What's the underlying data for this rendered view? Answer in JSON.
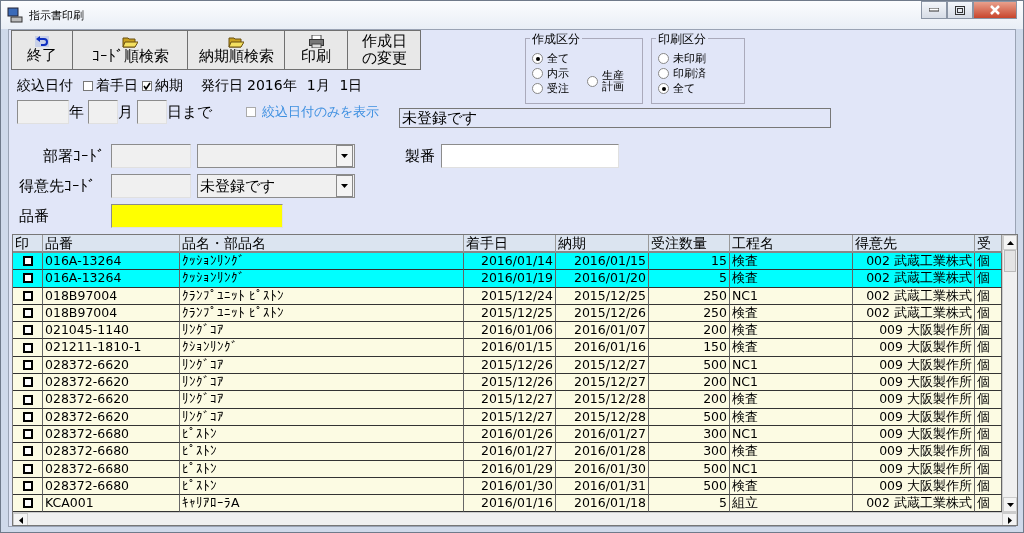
{
  "window": {
    "title": "指示書印刷"
  },
  "toolbar": [
    {
      "kind": "undo",
      "label": "終了"
    },
    {
      "kind": "folder",
      "label": "ｺｰﾄﾞ順検索"
    },
    {
      "kind": "folder",
      "label": "納期順検索"
    },
    {
      "kind": "printer",
      "label": "印刷"
    },
    {
      "kind": "text",
      "lines": [
        "作成日",
        "の変更"
      ]
    }
  ],
  "filter": {
    "label": "絞込日付",
    "checks": [
      {
        "label": "着手日",
        "checked": false
      },
      {
        "label": "納期",
        "checked": true
      }
    ],
    "issue_label": "発行日",
    "issue_year": "2016年",
    "issue_month": "1月",
    "issue_day": "1日",
    "year_unit": "年",
    "month_unit": "月",
    "day_unit": "日まで",
    "only_label": "絞込日付のみを表示",
    "only_checked": false,
    "status": "未登録です"
  },
  "groups": [
    {
      "title": "作成区分",
      "options": [
        {
          "label": "全て",
          "selected": true
        },
        {
          "label": "内示",
          "selected": false
        },
        {
          "label": "受注",
          "selected": false
        },
        {
          "lines": [
            "生産",
            "計画"
          ],
          "selected": false
        }
      ]
    },
    {
      "title": "印刷区分",
      "options": [
        {
          "label": "未印刷",
          "selected": false
        },
        {
          "label": "印刷済",
          "selected": false
        },
        {
          "label": "全て",
          "selected": true
        }
      ]
    }
  ],
  "fields": {
    "dept_label": "部署ｺｰﾄﾞ",
    "seiban_label": "製番",
    "customer_label": "得意先ｺｰﾄﾞ",
    "customer_value": "未登録です",
    "part_label": "品番"
  },
  "table": {
    "columns": [
      "印",
      "品番",
      "品名・部品名",
      "着手日",
      "納期",
      "受注数量",
      "工程名",
      "得意先",
      "受"
    ],
    "rows": [
      {
        "selected": true,
        "checked": false,
        "cells": [
          "",
          "016A-13264",
          "ｸｯｼｮﾝﾘﾝｸﾞ",
          "2016/01/14",
          "2016/01/15",
          "15",
          "検査",
          "002 武蔵工業株式",
          "個"
        ]
      },
      {
        "selected": true,
        "checked": false,
        "cells": [
          "",
          "016A-13264",
          "ｸｯｼｮﾝﾘﾝｸﾞ",
          "2016/01/19",
          "2016/01/20",
          "5",
          "検査",
          "002 武蔵工業株式",
          "個"
        ]
      },
      {
        "selected": false,
        "checked": false,
        "cells": [
          "",
          "018B97004",
          "ｸﾗﾝﾌﾟﾕﾆｯﾄ ﾋﾟｽﾄﾝ",
          "2015/12/24",
          "2015/12/25",
          "250",
          "NC1",
          "002 武蔵工業株式",
          "個"
        ]
      },
      {
        "selected": false,
        "checked": false,
        "cells": [
          "",
          "018B97004",
          "ｸﾗﾝﾌﾟﾕﾆｯﾄ ﾋﾟｽﾄﾝ",
          "2015/12/25",
          "2015/12/26",
          "250",
          "検査",
          "002 武蔵工業株式",
          "個"
        ]
      },
      {
        "selected": false,
        "checked": false,
        "cells": [
          "",
          "021045-1140",
          "ﾘﾝｸﾞｺｱ",
          "2016/01/06",
          "2016/01/07",
          "200",
          "検査",
          "009 大阪製作所",
          "個"
        ]
      },
      {
        "selected": false,
        "checked": false,
        "cells": [
          "",
          "021211-1810-1",
          "ｸｼｮﾝﾘﾝｸﾞ",
          "2016/01/15",
          "2016/01/16",
          "150",
          "検査",
          "009 大阪製作所",
          "個"
        ]
      },
      {
        "selected": false,
        "checked": false,
        "cells": [
          "",
          "028372-6620",
          "ﾘﾝｸﾞｺｱ",
          "2015/12/26",
          "2015/12/27",
          "500",
          "NC1",
          "009 大阪製作所",
          "個"
        ]
      },
      {
        "selected": false,
        "checked": false,
        "cells": [
          "",
          "028372-6620",
          "ﾘﾝｸﾞｺｱ",
          "2015/12/26",
          "2015/12/27",
          "200",
          "NC1",
          "009 大阪製作所",
          "個"
        ]
      },
      {
        "selected": false,
        "checked": false,
        "cells": [
          "",
          "028372-6620",
          "ﾘﾝｸﾞｺｱ",
          "2015/12/27",
          "2015/12/28",
          "200",
          "検査",
          "009 大阪製作所",
          "個"
        ]
      },
      {
        "selected": false,
        "checked": false,
        "cells": [
          "",
          "028372-6620",
          "ﾘﾝｸﾞｺｱ",
          "2015/12/27",
          "2015/12/28",
          "500",
          "検査",
          "009 大阪製作所",
          "個"
        ]
      },
      {
        "selected": false,
        "checked": false,
        "cells": [
          "",
          "028372-6680",
          "ﾋﾟｽﾄﾝ",
          "2016/01/26",
          "2016/01/27",
          "300",
          "NC1",
          "009 大阪製作所",
          "個"
        ]
      },
      {
        "selected": false,
        "checked": false,
        "cells": [
          "",
          "028372-6680",
          "ﾋﾟｽﾄﾝ",
          "2016/01/27",
          "2016/01/28",
          "300",
          "検査",
          "009 大阪製作所",
          "個"
        ]
      },
      {
        "selected": false,
        "checked": false,
        "cells": [
          "",
          "028372-6680",
          "ﾋﾟｽﾄﾝ",
          "2016/01/29",
          "2016/01/30",
          "500",
          "NC1",
          "009 大阪製作所",
          "個"
        ]
      },
      {
        "selected": false,
        "checked": false,
        "cells": [
          "",
          "028372-6680",
          "ﾋﾟｽﾄﾝ",
          "2016/01/30",
          "2016/01/31",
          "500",
          "検査",
          "009 大阪製作所",
          "個"
        ]
      },
      {
        "selected": false,
        "checked": false,
        "cells": [
          "",
          "KCA001",
          "ｷｬﾘｱﾛｰﾗA",
          "2016/01/16",
          "2016/01/18",
          "5",
          "組立",
          "002 武蔵工業株式",
          "個"
        ]
      }
    ]
  }
}
